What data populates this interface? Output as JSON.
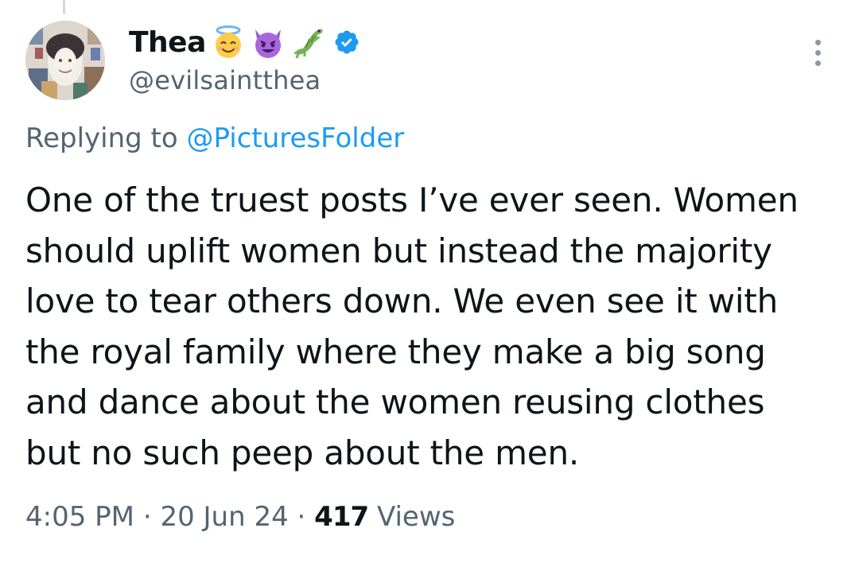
{
  "author": {
    "display_name": "Thea",
    "handle": "@evilsaintthea",
    "emojis": [
      "smiling-face-with-halo-icon",
      "smiling-imp-icon",
      "crocodile-icon"
    ],
    "verified_icon": "verified-badge-icon"
  },
  "reply_context": {
    "prefix": "Replying to",
    "mention": "@PicturesFolder"
  },
  "tweet": {
    "lines": [
      "One of the truest posts I’ve ever seen. Women",
      "should uplift women but instead the majority",
      "love to tear others down. We even see it with",
      "the royal family where they make a big song",
      "and dance about the women reusing clothes",
      "but no such peep about the men."
    ]
  },
  "meta": {
    "time": "4:05 PM",
    "separator": "·",
    "date": "20 Jun 24",
    "views_count": "417",
    "views_label": "Views"
  },
  "colors": {
    "text": "#0f1419",
    "secondary": "#536471",
    "accent": "#1d9bf0"
  }
}
